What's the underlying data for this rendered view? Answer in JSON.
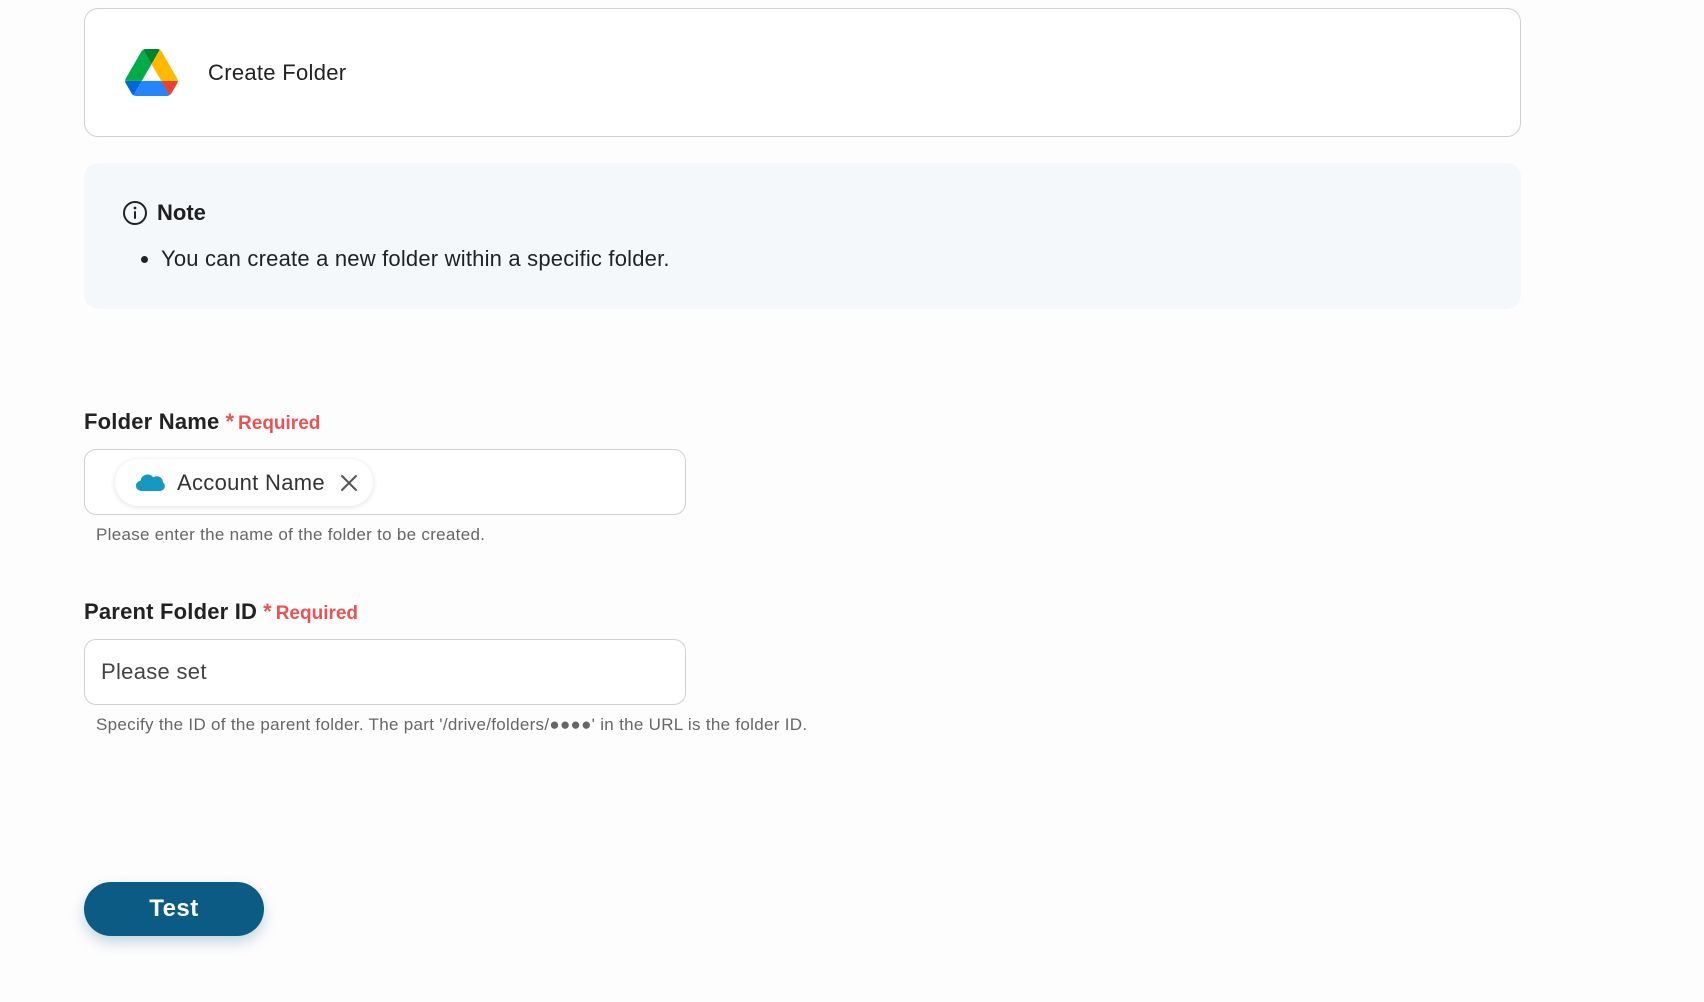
{
  "action": {
    "title": "Create Folder",
    "icon": "google-drive-icon"
  },
  "note": {
    "title": "Note",
    "items": [
      "You can create a new folder within a specific folder."
    ]
  },
  "fields": {
    "folder_name": {
      "label": "Folder Name",
      "required_marker": "*",
      "required_text": "Required",
      "chip_label": "Account Name",
      "chip_icon": "salesforce-cloud-icon",
      "help": "Please enter the name of the folder to be created."
    },
    "parent_folder_id": {
      "label": "Parent Folder ID",
      "required_marker": "*",
      "required_text": "Required",
      "placeholder": "Please set",
      "help": "Specify the ID of the parent folder. The part '/drive/folders/●●●●' in the URL is the folder ID."
    }
  },
  "test_button": {
    "label": "Test"
  },
  "colors": {
    "primary": "#0b5b85",
    "required": "#e85454",
    "note_bg": "#f4f8fb",
    "salesforce": "#1798c1"
  }
}
